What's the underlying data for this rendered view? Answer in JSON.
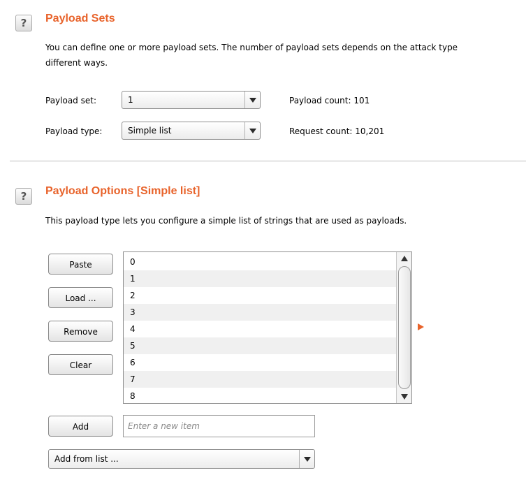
{
  "payload_sets": {
    "help_icon": "question-mark",
    "title": "Payload Sets",
    "desc_line1": "You can define one or more payload sets. The number of payload sets depends on the attack type",
    "desc_line2": "different ways.",
    "set_label": "Payload set:",
    "set_value": "1",
    "type_label": "Payload type:",
    "type_value": "Simple list",
    "payload_count": "Payload count:  101",
    "request_count": "Request count:  10,201"
  },
  "payload_options": {
    "help_icon": "question-mark",
    "title": "Payload Options [Simple list]",
    "desc": "This payload type lets you configure a simple list of strings that are used as payloads.",
    "buttons": {
      "paste": "Paste",
      "load": "Load ...",
      "remove": "Remove",
      "clear": "Clear",
      "add": "Add"
    },
    "items": [
      "0",
      "1",
      "2",
      "3",
      "4",
      "5",
      "6",
      "7",
      "8"
    ],
    "new_item_placeholder": "Enter a new item",
    "add_from_list": "Add from list ..."
  },
  "colors": {
    "accent": "#e8632b"
  }
}
